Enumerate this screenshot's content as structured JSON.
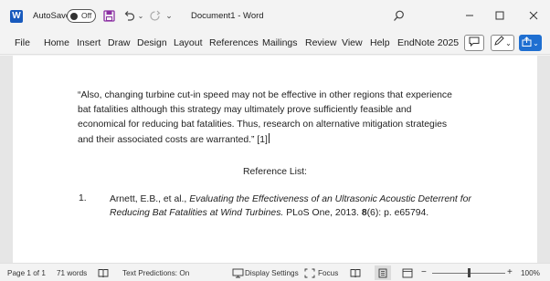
{
  "titlebar": {
    "app_logo": "W",
    "autosave_label": "AutoSave",
    "autosave_state": "Off",
    "document_title": "Document1 - Word"
  },
  "menu": {
    "items": [
      "File",
      "Home",
      "Insert",
      "Draw",
      "Design",
      "Layout",
      "References",
      "Mailings",
      "Review",
      "View",
      "Help",
      "EndNote 2025"
    ]
  },
  "document": {
    "quote_lines": [
      "“Also, changing turbine cut-in speed may not be effective in other regions that experience",
      "bat fatalities although this strategy may ultimately prove sufficiently feasible and",
      "economical for reducing bat fatalities. Thus, research on alternative mitigation strategies",
      "and their associated costs are warranted.” [1]"
    ],
    "reference_heading": "Reference List:",
    "reference": {
      "number": "1.",
      "authors": "Arnett, E.B., et al., ",
      "title": "Evaluating the Effectiveness of an Ultrasonic Acoustic Deterrent for Reducing Bat Fatalities at Wind Turbines.",
      "journal": " PLoS One, 2013. ",
      "volume": "8",
      "issue_pages": "(6): p. e65794."
    }
  },
  "statusbar": {
    "page": "Page 1 of 1",
    "words": "71 words",
    "text_predictions": "Text Predictions: On",
    "display_settings": "Display Settings",
    "focus": "Focus",
    "zoom": "100%",
    "zoom_minus": "−",
    "zoom_plus": "+"
  },
  "colors": {
    "accent": "#185abd",
    "share_button": "#1f6fd1"
  },
  "icons": [
    "word-logo-icon",
    "save-icon",
    "undo-icon",
    "redo-icon",
    "search-icon",
    "minimize-icon",
    "maximize-icon",
    "close-icon",
    "comment-icon",
    "pen-icon",
    "share-icon",
    "proofing-icon",
    "display-settings-icon",
    "focus-icon",
    "read-mode-icon",
    "print-layout-icon",
    "web-layout-icon"
  ]
}
